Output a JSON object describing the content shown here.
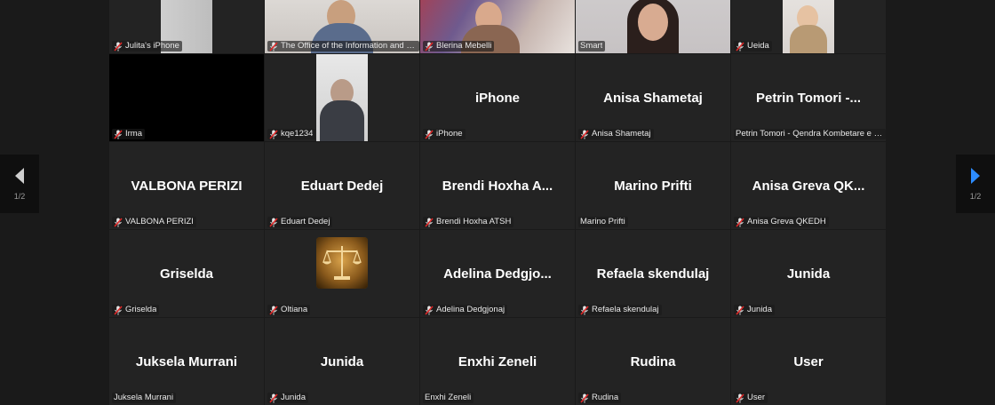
{
  "navigation": {
    "page_left": "1/2",
    "page_right": "1/2"
  },
  "tiles": [
    {
      "label": "Julita's iPhone",
      "display": "",
      "muted": true
    },
    {
      "label": "The Office of the Information and Dat...",
      "display": "",
      "muted": true
    },
    {
      "label": "Blerina Mebelli",
      "display": "",
      "muted": true
    },
    {
      "label": "Smart",
      "display": "",
      "muted": false
    },
    {
      "label": "Ueida",
      "display": "",
      "muted": true
    },
    {
      "label": "Irma",
      "display": "",
      "muted": true
    },
    {
      "label": "kqe1234",
      "display": "",
      "muted": true
    },
    {
      "label": "iPhone",
      "display": "iPhone",
      "muted": true
    },
    {
      "label": "Anisa Shametaj",
      "display": "Anisa Shametaj",
      "muted": true
    },
    {
      "label": "Petrin Tomori - Qendra Kombetare e Biz...",
      "display": "Petrin Tomori -...",
      "muted": false
    },
    {
      "label": "VALBONA PERIZI",
      "display": "VALBONA PERIZI",
      "muted": true
    },
    {
      "label": "Eduart Dedej",
      "display": "Eduart Dedej",
      "muted": true
    },
    {
      "label": "Brendi Hoxha ATSH",
      "display": "Brendi Hoxha A...",
      "muted": true
    },
    {
      "label": "Marino Prifti",
      "display": "Marino Prifti",
      "muted": false
    },
    {
      "label": "Anisa Greva QKEDH",
      "display": "Anisa Greva QK...",
      "muted": true
    },
    {
      "label": "Griselda",
      "display": "Griselda",
      "muted": true
    },
    {
      "label": "Oltiana",
      "display": "",
      "muted": true
    },
    {
      "label": "Adelina Dedgjonaj",
      "display": "Adelina Dedgjo...",
      "muted": true
    },
    {
      "label": "Refaela skendulaj",
      "display": "Refaela skendulaj",
      "muted": true
    },
    {
      "label": "Junida",
      "display": "Junida",
      "muted": true
    },
    {
      "label": "Juksela Murrani",
      "display": "Juksela Murrani",
      "muted": false
    },
    {
      "label": "Junida",
      "display": "Junida",
      "muted": true
    },
    {
      "label": "Enxhi Zeneli",
      "display": "Enxhi Zeneli",
      "muted": false
    },
    {
      "label": "Rudina",
      "display": "Rudina",
      "muted": true
    },
    {
      "label": "User",
      "display": "User",
      "muted": true
    }
  ],
  "colors": {
    "background": "#1a1a1a",
    "tile": "#232323",
    "active_speaker_border": "#23d959",
    "muted_icon": "#e02828",
    "nav_arrow_left": "#cfcfcf",
    "nav_arrow_right": "#2d8cff"
  },
  "icons": {
    "muted": "mic-muted-icon",
    "nav_prev": "chevron-left-icon",
    "nav_next": "chevron-right-icon"
  }
}
